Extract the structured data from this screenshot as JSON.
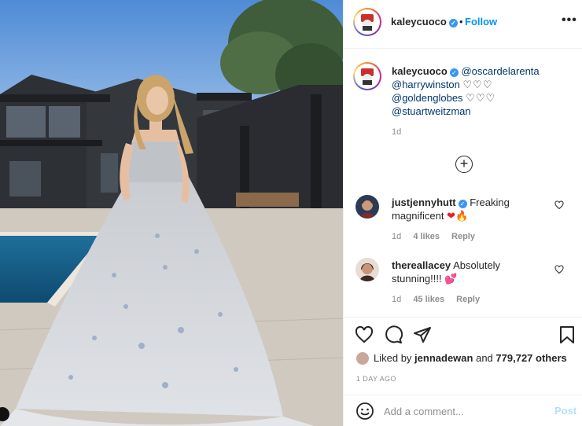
{
  "post": {
    "username": "kaleycuoco",
    "follow_label": "Follow",
    "more_label": "•••",
    "separator": "•"
  },
  "caption": {
    "username": "kaleycuoco",
    "mention1": "@oscardelarenta",
    "mention2": "@harrywinston",
    "mention3": "@goldenglobes",
    "mention4": "@stuartweitzman",
    "hearts": "♡♡♡",
    "time": "1d"
  },
  "load_more_label": "+",
  "comments": [
    {
      "username": "justjennyhutt",
      "text": "Freaking magnificent",
      "emoji": "❤🔥",
      "time": "1d",
      "likes": "4 likes",
      "reply": "Reply"
    },
    {
      "username": "thereallacey",
      "text": "Absolutely stunning!!!!",
      "emoji": "💕",
      "time": "1d",
      "likes": "45 likes",
      "reply": "Reply"
    }
  ],
  "likes": {
    "prefix": "Liked by",
    "user": "jennadewan",
    "and": "and",
    "count": "779,727 others"
  },
  "post_age": "1 DAY AGO",
  "add_comment": {
    "placeholder": "Add a comment...",
    "post_label": "Post"
  },
  "icons": {
    "like": "heart-outline-icon",
    "comment": "speech-bubble-icon",
    "share": "paper-plane-icon",
    "save": "bookmark-icon",
    "emoji": "smiley-icon",
    "comment_like": "small-heart-icon"
  },
  "colors": {
    "accent": "#0095f6",
    "post_disabled": "#b2dffc",
    "muted": "#8e8e8e",
    "mention": "#00376b"
  }
}
